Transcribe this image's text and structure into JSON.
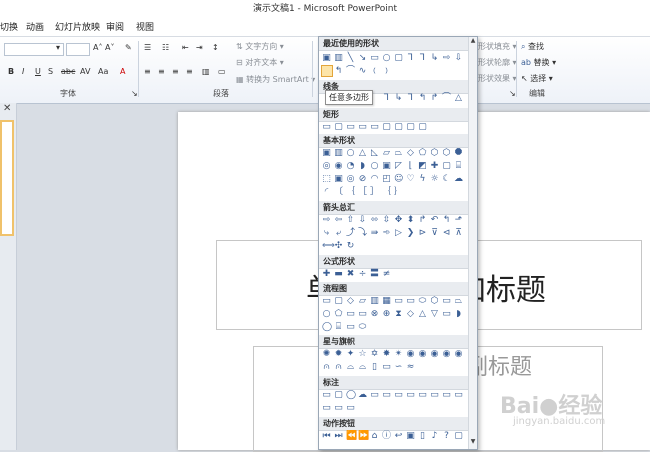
{
  "window": {
    "title": "演示文稿1 - Microsoft PowerPoint"
  },
  "tabs": [
    "切换",
    "动画",
    "幻灯片放映",
    "审阅",
    "视图"
  ],
  "ribbon": {
    "groups": {
      "font": "字体",
      "paragraph": "段落",
      "edit": "编辑"
    },
    "paragraph": {
      "text_direction": "文字方向",
      "align_text": "对齐文本",
      "convert_smartart": "转换为 SmartArt"
    },
    "drawing": {
      "fill": "形状填充",
      "outline": "形状轮廓",
      "effects": "形状效果"
    },
    "editing": {
      "find": "查找",
      "replace": "替换",
      "select": "选择"
    }
  },
  "slide": {
    "title": "单击此处添加标题",
    "subtitle": "单击此处添加副标题"
  },
  "shapes_menu": {
    "sections": [
      "最近使用的形状",
      "线条",
      "矩形",
      "基本形状",
      "箭头总汇",
      "公式形状",
      "流程图",
      "星与旗帜",
      "标注",
      "动作按钮"
    ],
    "tooltip": "任意多边形"
  },
  "watermark": {
    "logo": "Bai du 经验",
    "url": "jingyan.baidu.com"
  },
  "colors": {
    "accent": "#3b5f95",
    "hover": "#fde5a9"
  }
}
